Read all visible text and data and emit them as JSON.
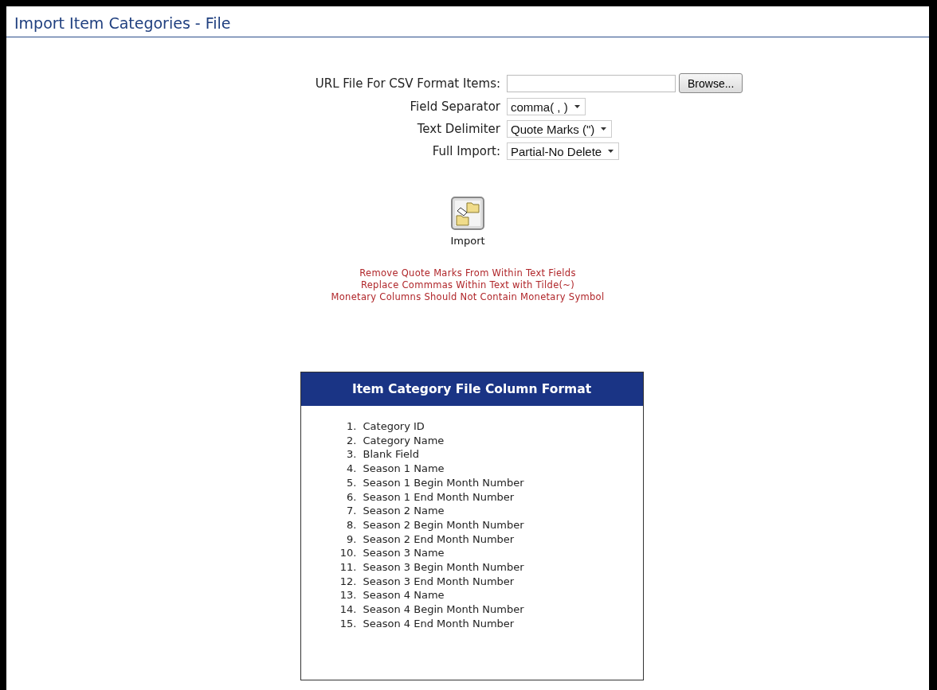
{
  "page": {
    "title": "Import Item Categories - File"
  },
  "form": {
    "fields": [
      {
        "kind": "file",
        "label": "URL File For CSV Format Items:",
        "button": "Browse..."
      },
      {
        "kind": "select",
        "label": "Field Separator",
        "value": "comma( , )"
      },
      {
        "kind": "select",
        "label": "Text Delimiter",
        "value": "Quote Marks (\")"
      },
      {
        "kind": "select",
        "label": "Full Import:",
        "value": "Partial-No Delete"
      }
    ],
    "import_button": {
      "label": "Import"
    }
  },
  "notes": [
    "Remove Quote Marks From Within Text Fields",
    "Replace Commmas Within Text with Tilde(~)",
    "Monetary Columns Should Not Contain Monetary Symbol"
  ],
  "format_box": {
    "title": "Item Category File Column Format",
    "columns": [
      {
        "number": "1.",
        "name": "Category ID"
      },
      {
        "number": "2.",
        "name": "Category Name"
      },
      {
        "number": "3.",
        "name": "Blank Field"
      },
      {
        "number": "4.",
        "name": "Season 1 Name"
      },
      {
        "number": "5.",
        "name": "Season 1 Begin Month Number"
      },
      {
        "number": "6.",
        "name": "Season 1 End Month Number"
      },
      {
        "number": "7.",
        "name": "Season 2 Name"
      },
      {
        "number": "8.",
        "name": "Season 2 Begin Month Number"
      },
      {
        "number": "9.",
        "name": "Season 2 End Month Number"
      },
      {
        "number": "10.",
        "name": "Season 3 Name"
      },
      {
        "number": "11.",
        "name": "Season 3 Begin Month Number"
      },
      {
        "number": "12.",
        "name": "Season 3 End Month Number"
      },
      {
        "number": "13.",
        "name": "Season 4 Name"
      },
      {
        "number": "14.",
        "name": "Season 4 Begin Month Number"
      },
      {
        "number": "15.",
        "name": "Season 4 End Month Number"
      }
    ]
  }
}
